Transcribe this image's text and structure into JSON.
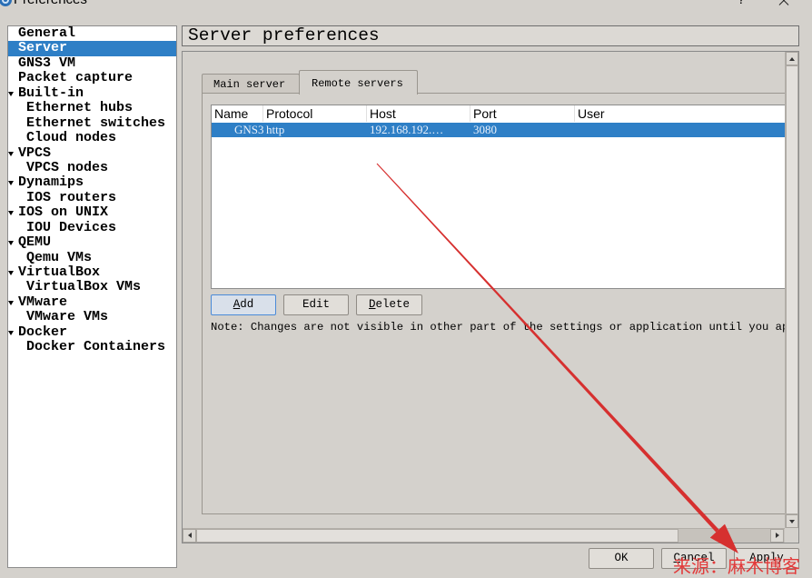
{
  "window": {
    "title": "Preferences",
    "help_label": "?"
  },
  "icons": {
    "app": "gns3-logo-icon",
    "close": "close-icon",
    "expand": "expand-arrow-icon",
    "scroll_up": "scroll-up-arrow-icon",
    "scroll_down": "scroll-down-arrow-icon",
    "scroll_left": "scroll-left-arrow-icon",
    "scroll_right": "scroll-right-arrow-icon"
  },
  "colors": {
    "dialog_bg": "#d4d1cc",
    "selection": "#2e7fc6",
    "focus_border": "#4a8ad8",
    "annotation": "#d6302f",
    "watermark": "#e23a3a"
  },
  "sidebar": {
    "items": [
      {
        "label": "General"
      },
      {
        "label": "Server",
        "selected": true
      },
      {
        "label": "GNS3 VM"
      },
      {
        "label": "Packet capture"
      },
      {
        "label": "Built-in",
        "expanded": true
      },
      {
        "label": "Ethernet hubs"
      },
      {
        "label": "Ethernet switches"
      },
      {
        "label": "Cloud nodes"
      },
      {
        "label": "VPCS",
        "expanded": true
      },
      {
        "label": "VPCS nodes"
      },
      {
        "label": "Dynamips",
        "expanded": true
      },
      {
        "label": "IOS routers"
      },
      {
        "label": "IOS on UNIX",
        "expanded": true
      },
      {
        "label": "IOU Devices"
      },
      {
        "label": "QEMU",
        "expanded": true
      },
      {
        "label": "Qemu VMs"
      },
      {
        "label": "VirtualBox",
        "expanded": true
      },
      {
        "label": "VirtualBox VMs"
      },
      {
        "label": "VMware",
        "expanded": true
      },
      {
        "label": "VMware VMs"
      },
      {
        "label": "Docker",
        "expanded": true
      },
      {
        "label": "Docker Containers"
      }
    ]
  },
  "page": {
    "title": "Server preferences"
  },
  "tabs": [
    {
      "label": "Main server"
    },
    {
      "label": "Remote servers"
    }
  ],
  "active_tab_index": 1,
  "servers_table": {
    "columns": [
      "Name",
      "Protocol",
      "Host",
      "Port",
      "User"
    ],
    "rows": [
      {
        "name": "GNS3",
        "protocol": "http",
        "host": "192.168.192.…",
        "port": "3080",
        "user": "",
        "selected": true
      }
    ]
  },
  "buttons": {
    "add": "Add",
    "edit": "Edit",
    "delete": "Delete"
  },
  "note": "Note: Changes are not visible in other part of the settings or application until you ap",
  "dialog_buttons": {
    "ok": "OK",
    "cancel": "Cancel",
    "apply": "Apply"
  },
  "watermark": "来源：麻木博客"
}
